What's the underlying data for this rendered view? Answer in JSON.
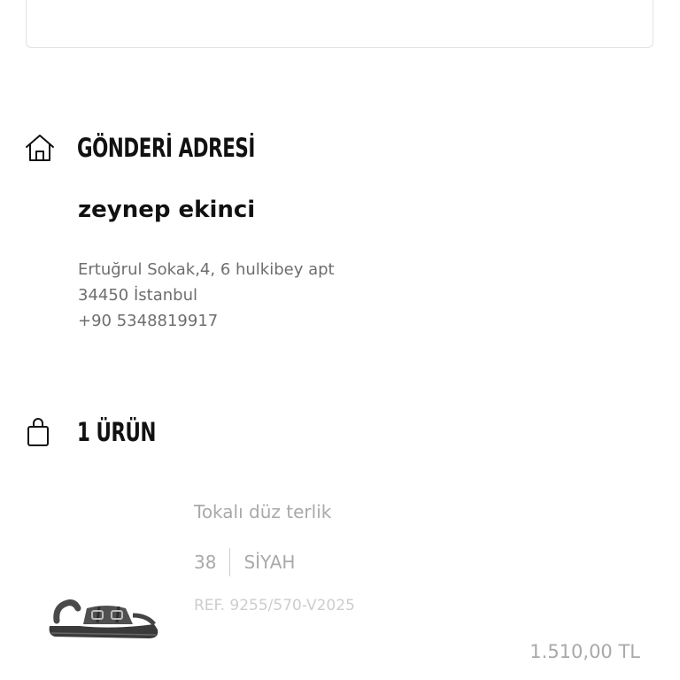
{
  "shipping_address": {
    "title": "GÖNDERİ ADRESİ",
    "icon": "home-icon",
    "recipient_name": "zeynep ekinci",
    "address_line1": "Ertuğrul Sokak,4, 6 hulkibey apt",
    "address_line2": "34450 İstanbul",
    "phone": "+90 5348819917"
  },
  "products_section": {
    "title": "1 ÜRÜN",
    "icon": "shopping-bag-icon",
    "items": [
      {
        "name": "Tokalı düz terlik",
        "size": "38",
        "color": "SİYAH",
        "ref": "REF. 9255/570-V2025",
        "price": "1.510,00 TL",
        "image_icon": "sandal-image"
      }
    ]
  }
}
